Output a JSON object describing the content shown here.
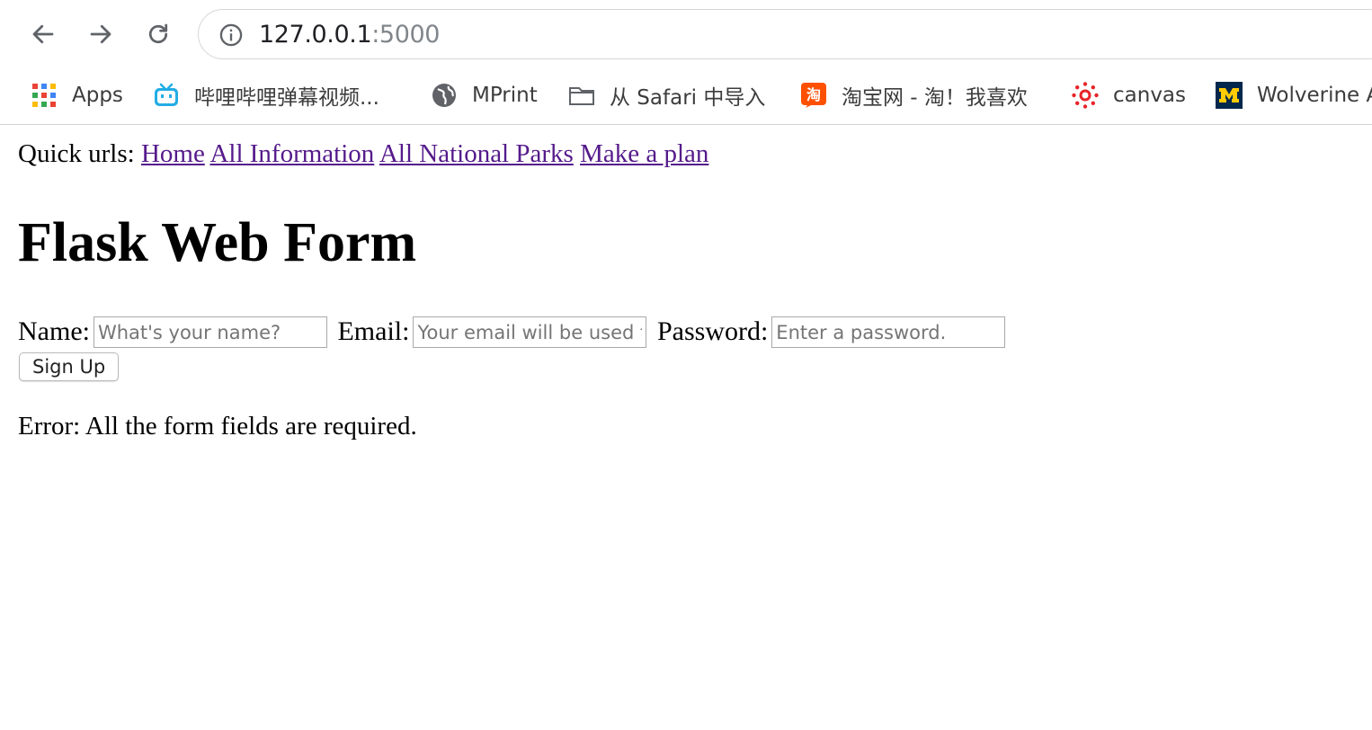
{
  "browser": {
    "url_host": "127.0.0.1",
    "url_port": ":5000",
    "bookmarks": [
      {
        "label": "Apps",
        "icon": "apps-grid-icon"
      },
      {
        "label": "哔哩哔哩弹幕视频...",
        "icon": "bilibili-icon"
      },
      {
        "label": "MPrint",
        "icon": "globe-icon"
      },
      {
        "label": "从 Safari 中导入",
        "icon": "folder-icon"
      },
      {
        "label": "淘宝网 - 淘！我喜欢",
        "icon": "taobao-icon"
      },
      {
        "label": "canvas",
        "icon": "canvas-icon"
      },
      {
        "label": "Wolverine A",
        "icon": "michigan-m-icon"
      }
    ]
  },
  "page": {
    "quick_urls_label": "Quick urls:",
    "links": [
      "Home",
      "All Information",
      "All National Parks",
      "Make a plan"
    ],
    "title": "Flask Web Form",
    "form": {
      "name_label": "Name:",
      "name_placeholder": "What's your name?",
      "email_label": "Email:",
      "email_placeholder": "Your email will be used to contact you.",
      "password_label": "Password:",
      "password_placeholder": "Enter a password.",
      "submit_label": "Sign Up"
    },
    "error_text": "Error: All the form fields are required."
  },
  "colors": {
    "visited_link": "#551a8b",
    "bilibili": "#23ade5",
    "taobao": "#ff5000",
    "canvas": "#e72429",
    "michigan_blue": "#00274c",
    "michigan_maize": "#ffcb05"
  }
}
